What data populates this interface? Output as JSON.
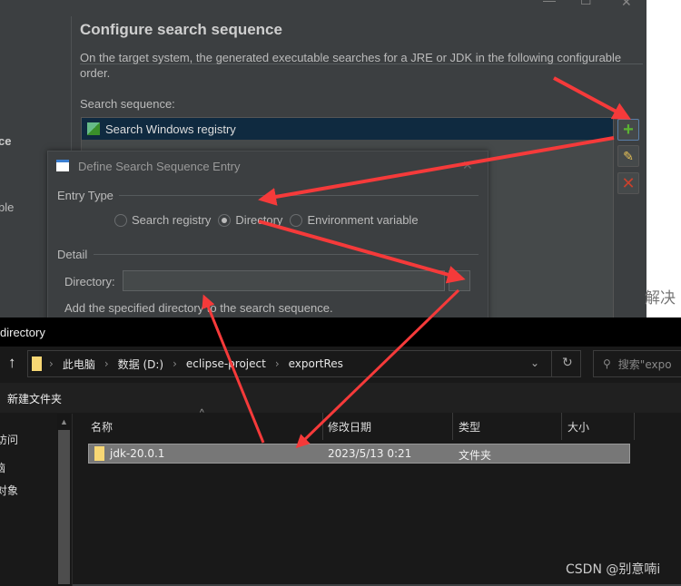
{
  "window_controls": {
    "minimize": "—",
    "maximize": "☐",
    "close": "✕"
  },
  "left_panel": {
    "fragments": [
      "ce",
      "ble"
    ]
  },
  "page": {
    "title": "Configure search sequence",
    "description": "On the target system, the generated executable searches for a JRE or JDK in the following configurable order.",
    "sequence_label": "Search sequence:",
    "sequence_items": [
      {
        "label": "Search Windows registry",
        "selected": true
      }
    ],
    "side_buttons": {
      "add": "add-icon",
      "edit": "edit-icon",
      "delete": "delete-icon"
    }
  },
  "right_strip_text": "解决",
  "dialog": {
    "title": "Define Search Sequence Entry",
    "close": "✕",
    "entry_type_label": "Entry Type",
    "options": [
      {
        "label": "Search registry",
        "selected": false
      },
      {
        "label": "Directory",
        "selected": true
      },
      {
        "label": "Environment variable",
        "selected": false
      }
    ],
    "detail_label": "Detail",
    "directory_label": "Directory:",
    "directory_value": "",
    "browse_label": "...",
    "hint": "Add the specified directory to the search sequence."
  },
  "explorer": {
    "title": "directory",
    "breadcrumb": [
      "此电脑",
      "数据 (D:)",
      "eclipse-project",
      "exportRes"
    ],
    "search_placeholder": "搜索\"expo",
    "new_folder": "新建文件夹",
    "nav_items": [
      "访问",
      "脑",
      "对象"
    ],
    "columns": [
      "名称",
      "修改日期",
      "类型",
      "大小"
    ],
    "rows": [
      {
        "name": "jdk-20.0.1",
        "date": "2023/5/13 0:21",
        "type": "文件夹",
        "size": "",
        "selected": true
      }
    ]
  },
  "watermark": "CSDN @别意喃i",
  "colors": {
    "arrow": "#f53a3a",
    "selection": "#0f2a40",
    "accent_add": "#5bb333",
    "delete": "#c9412c"
  }
}
